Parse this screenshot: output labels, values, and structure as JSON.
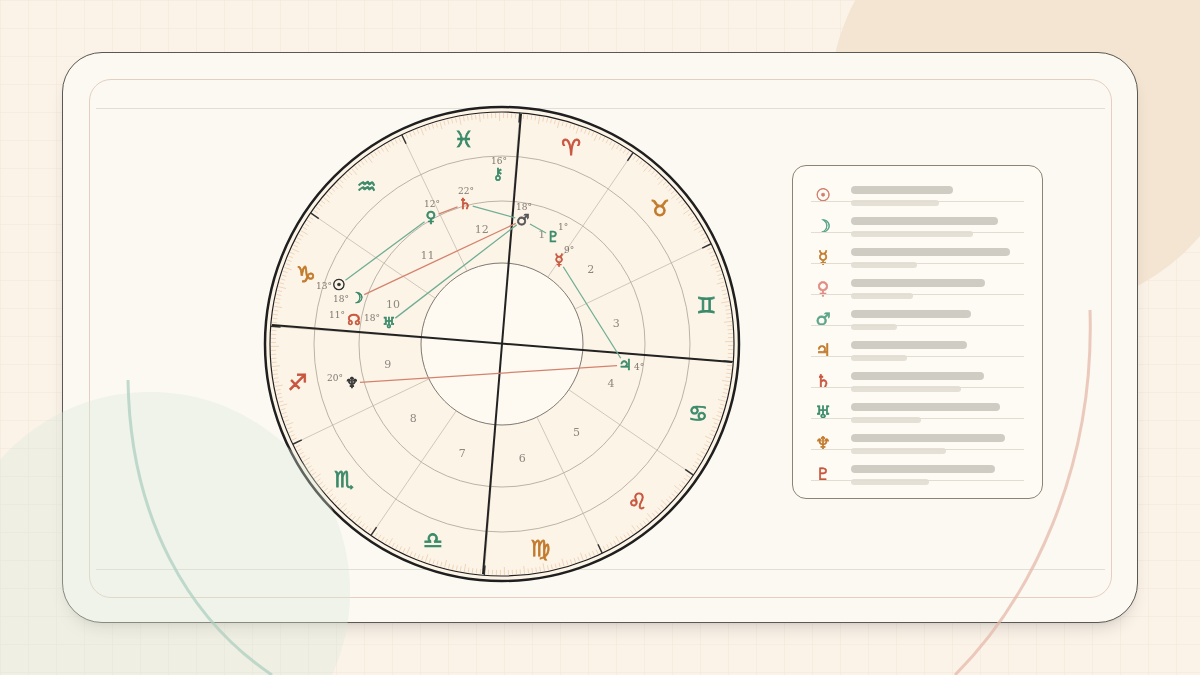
{
  "chart": {
    "signs": [
      {
        "glyph": "♈",
        "color": "#c8553d"
      },
      {
        "glyph": "♉",
        "color": "#c27a2c"
      },
      {
        "glyph": "♊",
        "color": "#3a8a6a"
      },
      {
        "glyph": "♋",
        "color": "#3a8a6a"
      },
      {
        "glyph": "♌",
        "color": "#c8553d"
      },
      {
        "glyph": "♍",
        "color": "#c27a2c"
      },
      {
        "glyph": "♎",
        "color": "#3a8a6a"
      },
      {
        "glyph": "♏",
        "color": "#3a8a6a"
      },
      {
        "glyph": "♐",
        "color": "#c8553d"
      },
      {
        "glyph": "♑",
        "color": "#c27a2c"
      },
      {
        "glyph": "♒",
        "color": "#3a8a6a"
      },
      {
        "glyph": "♓",
        "color": "#3a8a6a"
      }
    ],
    "houses": [
      "1",
      "2",
      "3",
      "4",
      "5",
      "6",
      "7",
      "8",
      "9",
      "10",
      "11",
      "12"
    ],
    "planets": [
      {
        "glyph": "☉",
        "degree": "13°",
        "color": "#333333"
      },
      {
        "glyph": "☽",
        "degree": "18°",
        "color": "#3a8a6a"
      },
      {
        "glyph": "☊",
        "degree": "11°",
        "color": "#c8553d"
      },
      {
        "glyph": "♅",
        "degree": "18°",
        "color": "#3a8a6a"
      },
      {
        "glyph": "♀",
        "degree": "12°",
        "color": "#3a8a6a"
      },
      {
        "glyph": "♄",
        "degree": "22°",
        "color": "#c8553d"
      },
      {
        "glyph": "⚷",
        "degree": "16°",
        "color": "#3a8a6a"
      },
      {
        "glyph": "♂",
        "degree": "18°",
        "color": "#555555"
      },
      {
        "glyph": "♇",
        "degree": "1°",
        "color": "#3a8a6a"
      },
      {
        "glyph": "☿",
        "degree": "9°",
        "color": "#c8553d"
      },
      {
        "glyph": "♃",
        "degree": "4°",
        "color": "#3a8a6a"
      },
      {
        "glyph": "♆",
        "degree": "20°",
        "color": "#333333"
      }
    ]
  },
  "legend": [
    {
      "glyph": "☉",
      "color": "#d27e6e"
    },
    {
      "glyph": "☽",
      "color": "#5aa58a"
    },
    {
      "glyph": "☿",
      "color": "#c27a2c"
    },
    {
      "glyph": "♀",
      "color": "#e08c84"
    },
    {
      "glyph": "♂",
      "color": "#5aa58a"
    },
    {
      "glyph": "♃",
      "color": "#c27a2c"
    },
    {
      "glyph": "♄",
      "color": "#c8553d"
    },
    {
      "glyph": "♅",
      "color": "#3a8a6a"
    },
    {
      "glyph": "♆",
      "color": "#c27a2c"
    },
    {
      "glyph": "♇",
      "color": "#c8553d"
    }
  ]
}
